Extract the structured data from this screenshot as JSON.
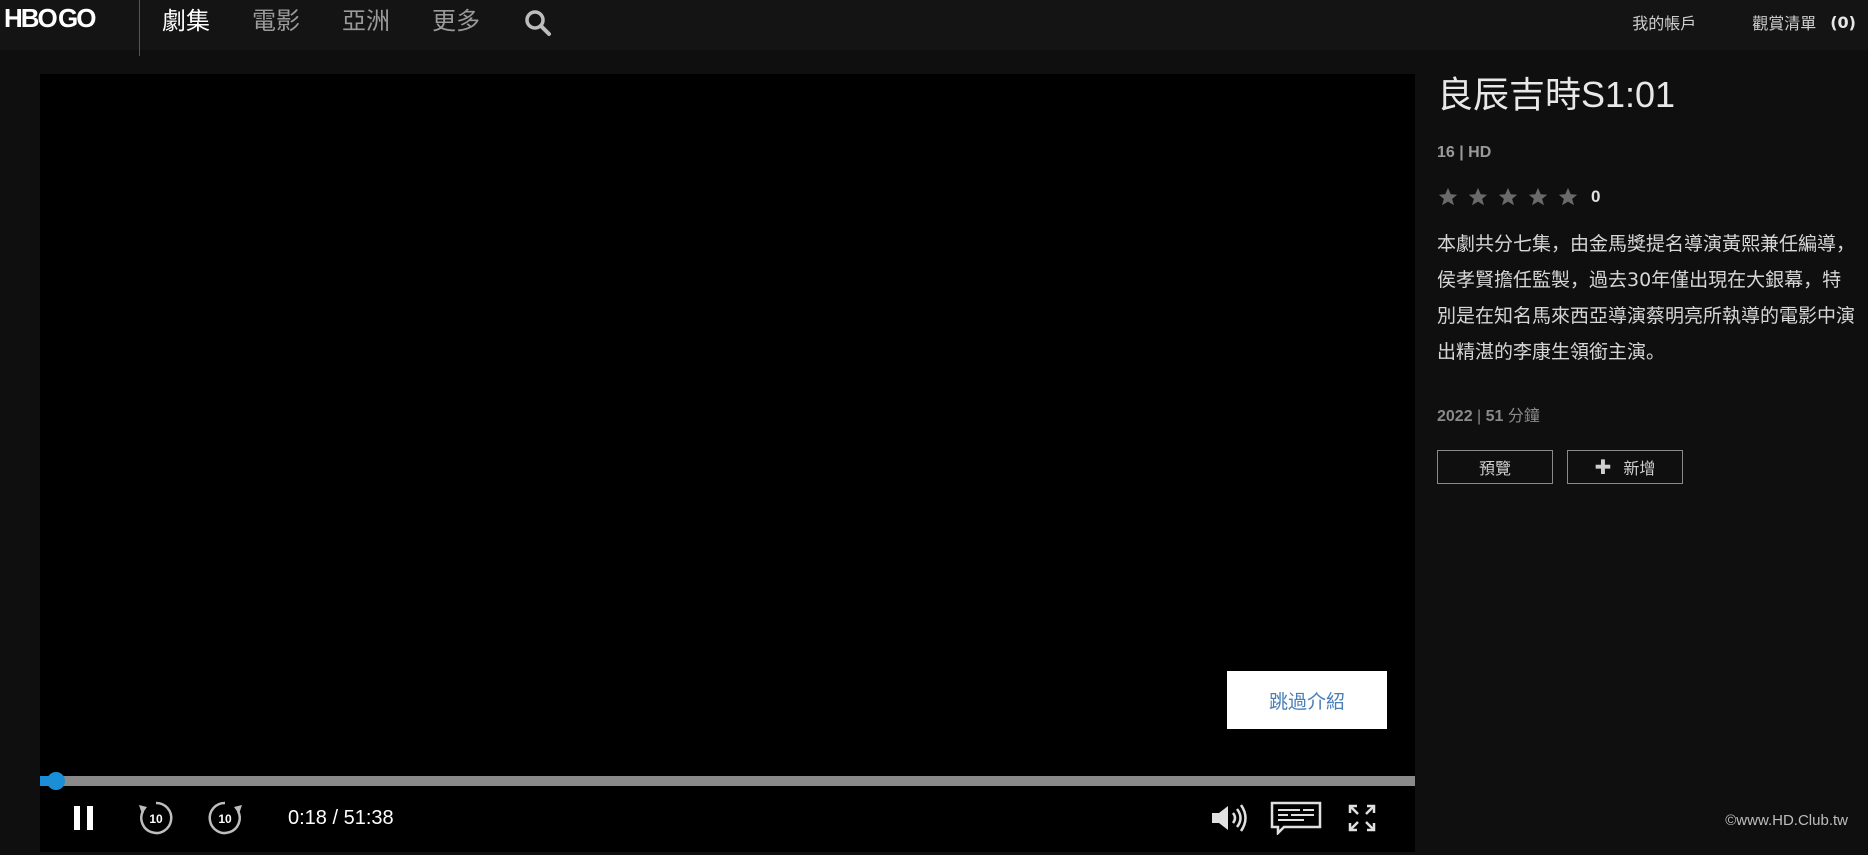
{
  "header": {
    "logo": "HBO GO",
    "nav": [
      {
        "label": "劇集",
        "active": true
      },
      {
        "label": "電影",
        "active": false
      },
      {
        "label": "亞洲",
        "active": false
      },
      {
        "label": "更多",
        "active": false
      }
    ],
    "search_icon": "search-icon",
    "account_label": "我的帳戶",
    "watchlist_label": "觀賞清單",
    "watchlist_count": "(0)"
  },
  "player": {
    "skip_intro_label": "跳過介紹",
    "current_time": "0:18",
    "duration": "51:38",
    "time_display": "0:18 / 51:38",
    "progress_fraction": 0.0058,
    "controls": {
      "pause": "pause-icon",
      "rewind": "rewind-10-icon",
      "rewind_label": "10",
      "forward": "forward-10-icon",
      "forward_label": "10",
      "volume": "volume-icon",
      "subtitles": "subtitles-icon",
      "fullscreen": "fullscreen-icon"
    },
    "accent_color": "#1a8fd8"
  },
  "info": {
    "title": "良辰吉時S1:01",
    "rating_meta": "16 | HD",
    "stars_total": 5,
    "rating_value": "0",
    "description": "本劇共分七集，由金馬獎提名導演黃熙兼任編導，侯孝賢擔任監製，過去30年僅出現在大銀幕，特別是在知名馬來西亞導演蔡明亮所執導的電影中演出精湛的李康生領銜主演。",
    "year": "2022",
    "duration_num": "51",
    "duration_unit": "分鐘",
    "preview_button": "預覽",
    "add_button": "新增"
  },
  "watermark": "©www.HD.Club.tw"
}
